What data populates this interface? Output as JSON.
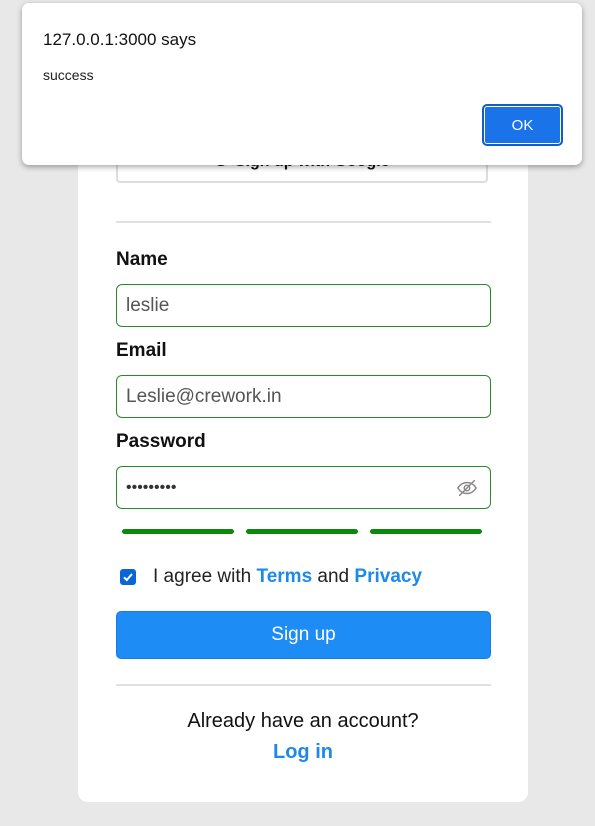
{
  "form": {
    "google_button_label": "Sign up with Google",
    "name_label": "Name",
    "name_value": "leslie",
    "email_label": "Email",
    "email_value": "Leslie@crework.in",
    "password_label": "Password",
    "password_value": "•••••••••",
    "password_strength_bars": 3,
    "agree_prefix": "I agree with",
    "terms_link": "Terms",
    "agree_and": "and",
    "privacy_link": "Privacy",
    "agree_checked": true,
    "signup_button": "Sign up",
    "already_text": "Already have an account?",
    "login_link": "Log in"
  },
  "alert": {
    "title": "127.0.0.1:3000 says",
    "message": "success",
    "ok_label": "OK"
  },
  "colors": {
    "accent": "#1d8df5",
    "field_border": "#2a8a2a",
    "strength": "#0a8a0a",
    "link": "#1e8ae8"
  },
  "icons": {
    "google": "google-icon",
    "password_visibility": "eye-off-icon",
    "checkbox": "check-icon"
  }
}
